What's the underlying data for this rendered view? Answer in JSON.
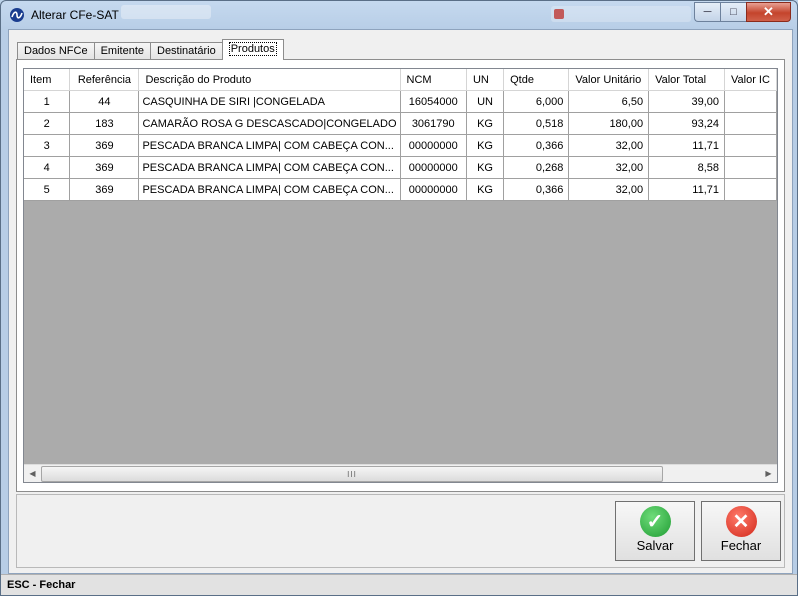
{
  "window": {
    "title": "Alterar CFe-SAT",
    "icon": "app-logo-icon",
    "controls": {
      "minimize": "─",
      "maximize": "□",
      "close": "✕"
    }
  },
  "tabs": [
    {
      "label": "Dados NFCe",
      "active": false
    },
    {
      "label": "Emitente",
      "active": false
    },
    {
      "label": "Destinatário",
      "active": false
    },
    {
      "label": "Produtos",
      "active": true
    }
  ],
  "grid": {
    "columns": [
      "Item",
      "Referência",
      "Descrição do Produto",
      "NCM",
      "UN",
      "Qtde",
      "Valor Unitário",
      "Valor Total",
      "Valor IC"
    ],
    "rows": [
      [
        "1",
        "44",
        "CASQUINHA DE SIRI |CONGELADA",
        "16054000",
        "UN",
        "6,000",
        "6,50",
        "39,00",
        ""
      ],
      [
        "2",
        "183",
        "CAMARÃO ROSA G DESCASCADO|CONGELADO",
        "3061790",
        "KG",
        "0,518",
        "180,00",
        "93,24",
        ""
      ],
      [
        "3",
        "369",
        "PESCADA BRANCA LIMPA| COM CABEÇA CON...",
        "00000000",
        "KG",
        "0,366",
        "32,00",
        "11,71",
        ""
      ],
      [
        "4",
        "369",
        "PESCADA BRANCA LIMPA| COM CABEÇA CON...",
        "00000000",
        "KG",
        "0,268",
        "32,00",
        "8,58",
        ""
      ],
      [
        "5",
        "369",
        "PESCADA BRANCA LIMPA| COM CABEÇA CON...",
        "00000000",
        "KG",
        "0,366",
        "32,00",
        "11,71",
        ""
      ]
    ],
    "scroll_thumb_grip": "III"
  },
  "buttons": {
    "save_label": "Salvar",
    "close_label": "Fechar"
  },
  "status": {
    "text": "ESC - Fechar"
  },
  "colors": {
    "save": "#1f9c33",
    "close": "#d1281a",
    "titlebar": "#c5d9ef"
  }
}
